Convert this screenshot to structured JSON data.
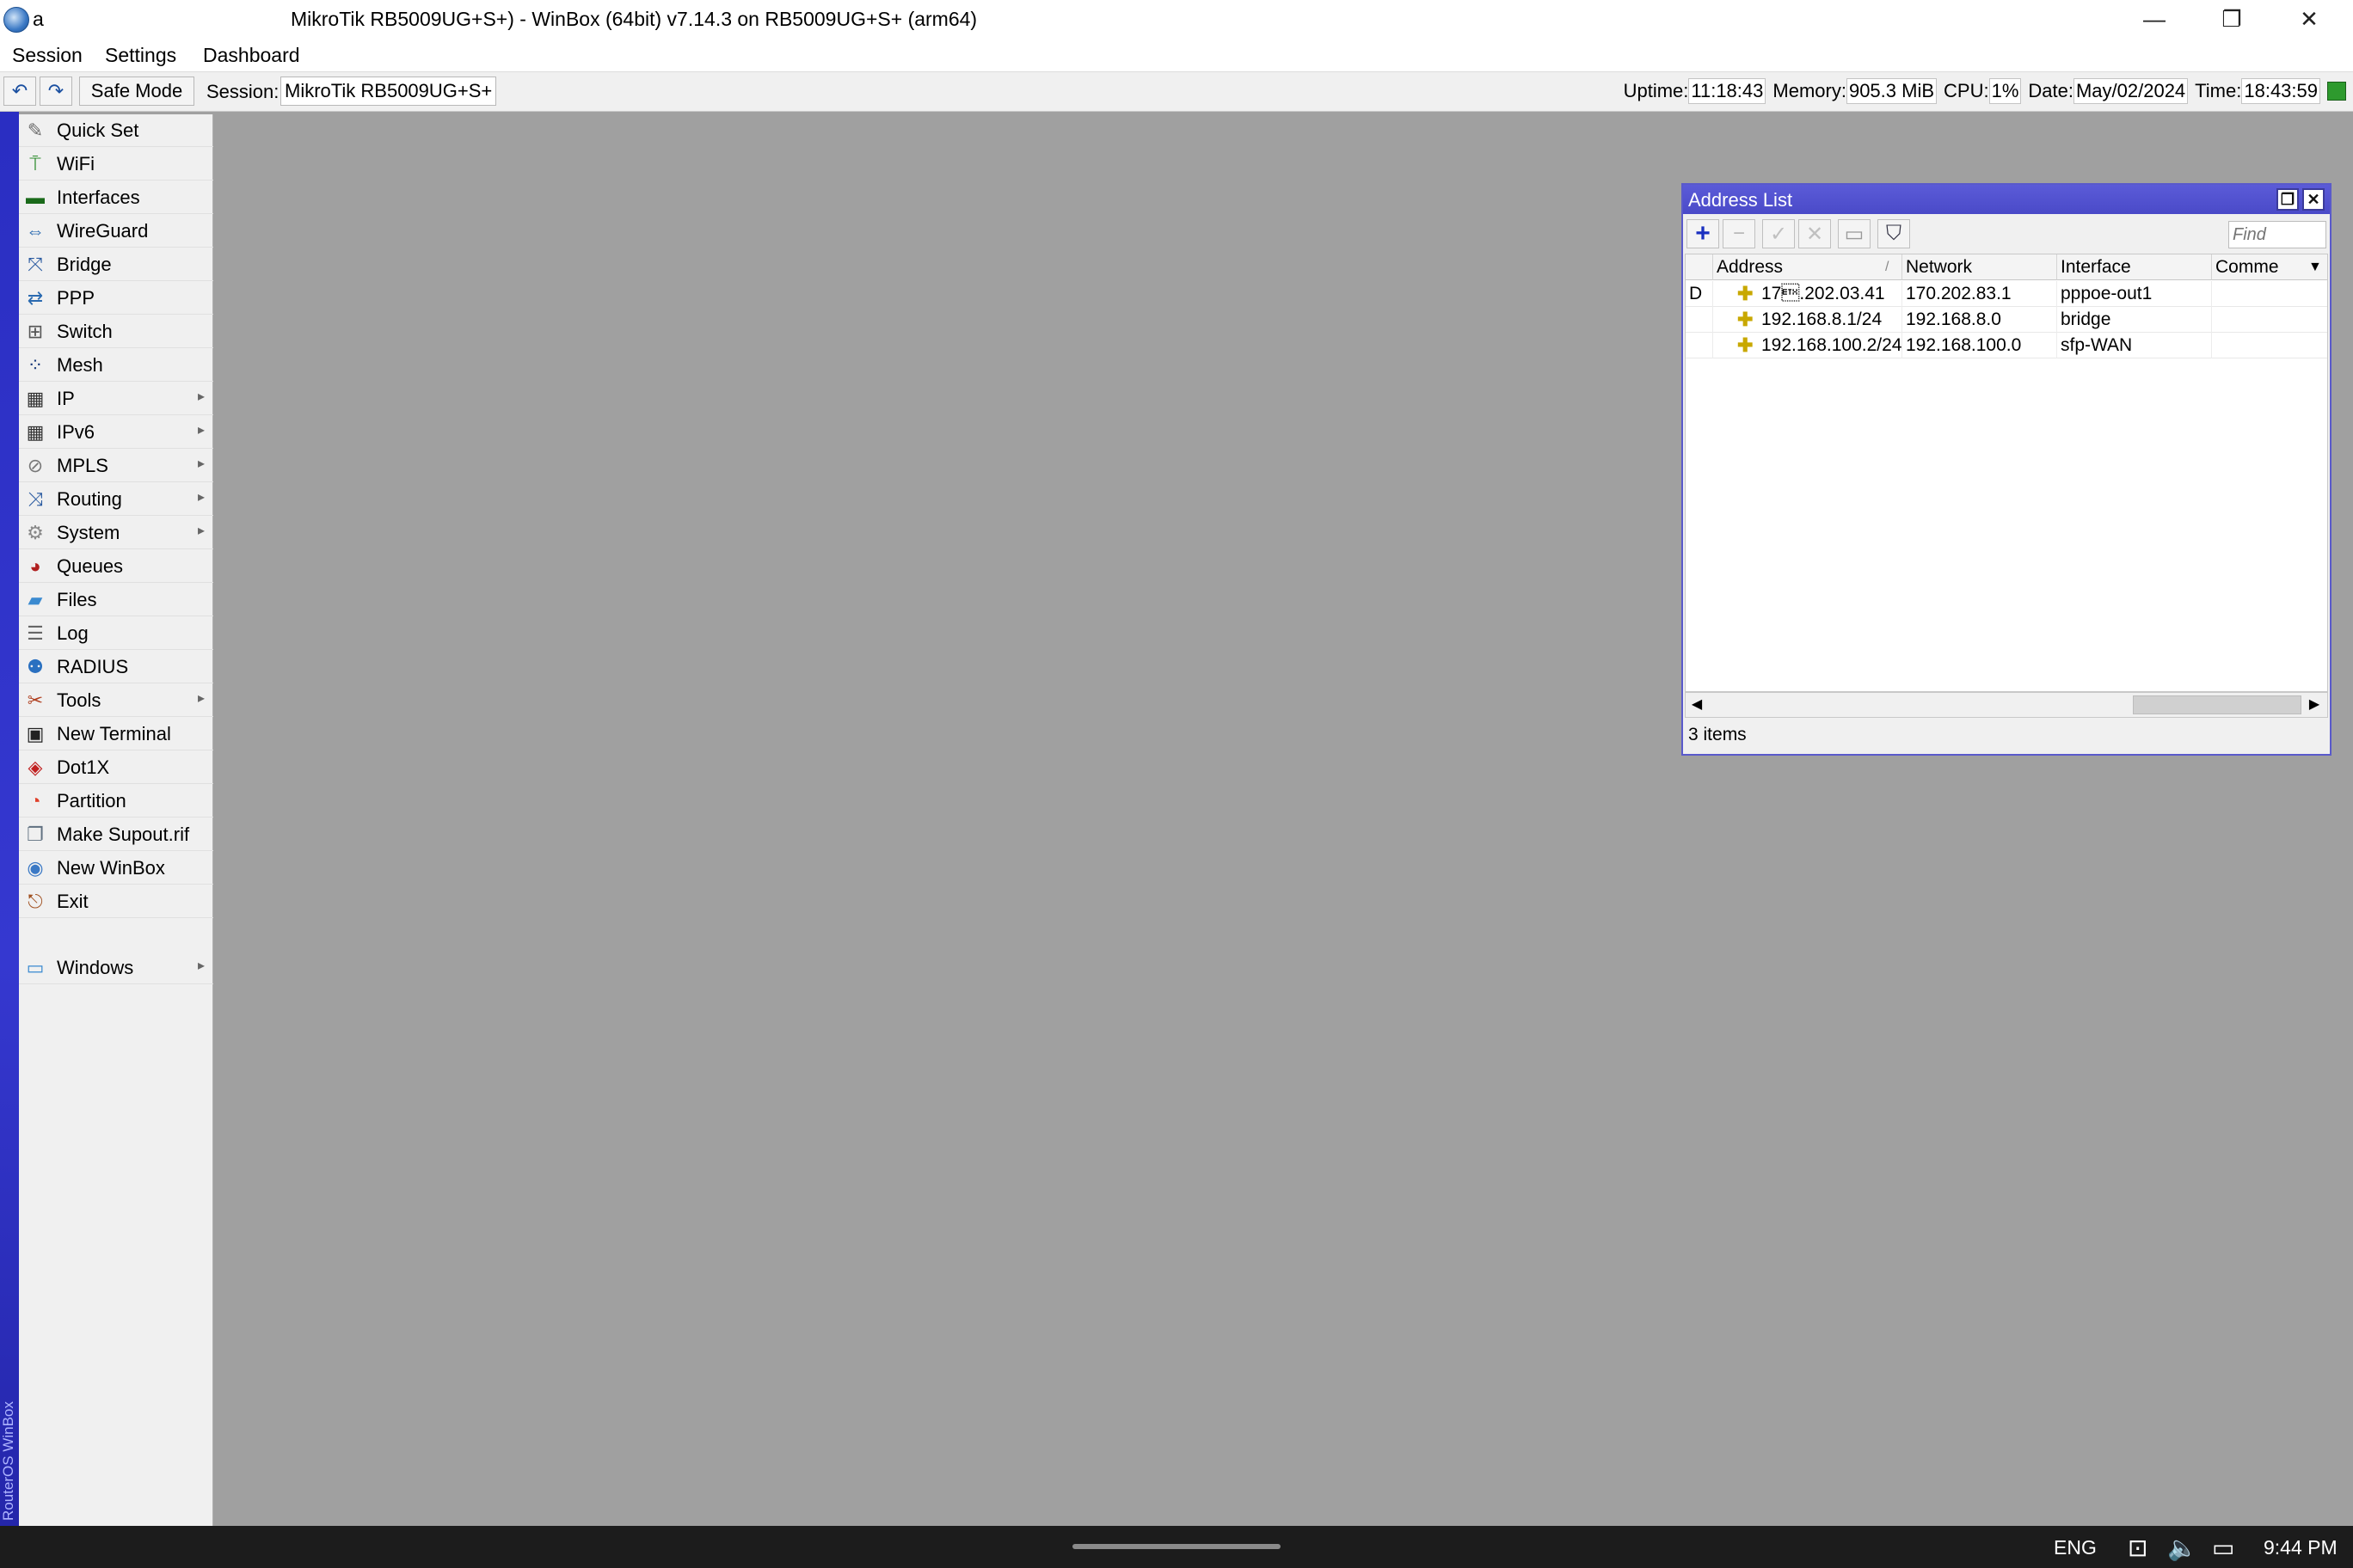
{
  "window": {
    "title_prefix": "a",
    "title": "MikroTik RB5009UG+S+) - WinBox (64bit) v7.14.3 on RB5009UG+S+ (arm64)",
    "minimize": "—",
    "maximize": "❐",
    "close": "✕"
  },
  "menu": [
    "Session",
    "Settings",
    "Dashboard"
  ],
  "toolbar": {
    "undo": "↶",
    "redo": "↷",
    "safe_mode": "Safe Mode",
    "session_label": "Session:",
    "session_value": "MikroTik RB5009UG+S+",
    "uptime_label": "Uptime:",
    "uptime": "11:18:43",
    "memory_label": "Memory:",
    "memory": "905.3 MiB",
    "cpu_label": "CPU:",
    "cpu": "1%",
    "date_label": "Date:",
    "date": "May/02/2024",
    "time_label": "Time:",
    "time": "18:43:59",
    "led_color": "#2e9a2e"
  },
  "brand": "RouterOS WinBox",
  "sidebar": [
    {
      "label": "Quick Set",
      "icon": "wand-icon",
      "glyph": "✎",
      "submenu": false
    },
    {
      "label": "WiFi",
      "icon": "antenna-icon",
      "glyph": "⍑",
      "submenu": false
    },
    {
      "label": "Interfaces",
      "icon": "ethernet-port-icon",
      "glyph": "▬",
      "submenu": false
    },
    {
      "label": "WireGuard",
      "icon": "wireguard-icon",
      "glyph": "⇔",
      "submenu": false
    },
    {
      "label": "Bridge",
      "icon": "bridge-icon",
      "glyph": "⤧",
      "submenu": false
    },
    {
      "label": "PPP",
      "icon": "ppp-icon",
      "glyph": "⇄",
      "submenu": false
    },
    {
      "label": "Switch",
      "icon": "switch-icon",
      "glyph": "⊞",
      "submenu": false
    },
    {
      "label": "Mesh",
      "icon": "mesh-icon",
      "glyph": "⁘",
      "submenu": false
    },
    {
      "label": "IP",
      "icon": "ip-icon",
      "glyph": "▦",
      "submenu": true
    },
    {
      "label": "IPv6",
      "icon": "ipv6-icon",
      "glyph": "▦",
      "submenu": true
    },
    {
      "label": "MPLS",
      "icon": "mpls-icon",
      "glyph": "⊘",
      "submenu": true
    },
    {
      "label": "Routing",
      "icon": "routing-icon",
      "glyph": "⤨",
      "submenu": true
    },
    {
      "label": "System",
      "icon": "gear-icon",
      "glyph": "⚙",
      "submenu": true
    },
    {
      "label": "Queues",
      "icon": "queues-icon",
      "glyph": "◕",
      "submenu": false
    },
    {
      "label": "Files",
      "icon": "folder-icon",
      "glyph": "▰",
      "submenu": false
    },
    {
      "label": "Log",
      "icon": "log-icon",
      "glyph": "☰",
      "submenu": false
    },
    {
      "label": "RADIUS",
      "icon": "radius-icon",
      "glyph": "⚉",
      "submenu": false
    },
    {
      "label": "Tools",
      "icon": "tools-icon",
      "glyph": "✂",
      "submenu": true
    },
    {
      "label": "New Terminal",
      "icon": "terminal-icon",
      "glyph": "▣",
      "submenu": false
    },
    {
      "label": "Dot1X",
      "icon": "dot1x-icon",
      "glyph": "◈",
      "submenu": false
    },
    {
      "label": "Partition",
      "icon": "partition-icon",
      "glyph": "◔",
      "submenu": false
    },
    {
      "label": "Make Supout.rif",
      "icon": "supout-file-icon",
      "glyph": "❐",
      "submenu": false
    },
    {
      "label": "New WinBox",
      "icon": "winbox-icon",
      "glyph": "◉",
      "submenu": false
    },
    {
      "label": "Exit",
      "icon": "exit-icon",
      "glyph": "⎋",
      "submenu": false
    },
    {
      "label": "Windows",
      "icon": "windows-icon",
      "glyph": "▭",
      "submenu": true
    }
  ],
  "submenu_arrow": "▸",
  "address_list": {
    "title": "Address List",
    "restore": "❐",
    "close": "✕",
    "tools": {
      "add": "+",
      "remove": "−",
      "enable": "✓",
      "disable": "✕",
      "comment": "▭",
      "filter": "⛉"
    },
    "find_placeholder": "Find",
    "columns": [
      "",
      "Address",
      "Network",
      "Interface",
      "Comme"
    ],
    "sort_marker": "/",
    "column_menu": "▼",
    "rows": [
      {
        "flag": "D",
        "address": "17\u0003.202.03.41",
        "network": "170.202.83.1",
        "interface": "pppoe-out1",
        "comment": ""
      },
      {
        "flag": "",
        "address": "192.168.8.1/24",
        "network": "192.168.8.0",
        "interface": "bridge",
        "comment": ""
      },
      {
        "flag": "",
        "address": "192.168.100.2/24",
        "network": "192.168.100.0",
        "interface": "sfp-WAN",
        "comment": ""
      }
    ],
    "row_icon": "✚",
    "scroll_left": "◀",
    "scroll_right": "▶",
    "status": "3 items"
  },
  "taskbar": {
    "lang": "ENG",
    "network_icon": "⊡",
    "volume_icon": "🔈",
    "battery_icon": "▭",
    "time": "9:44 PM"
  }
}
